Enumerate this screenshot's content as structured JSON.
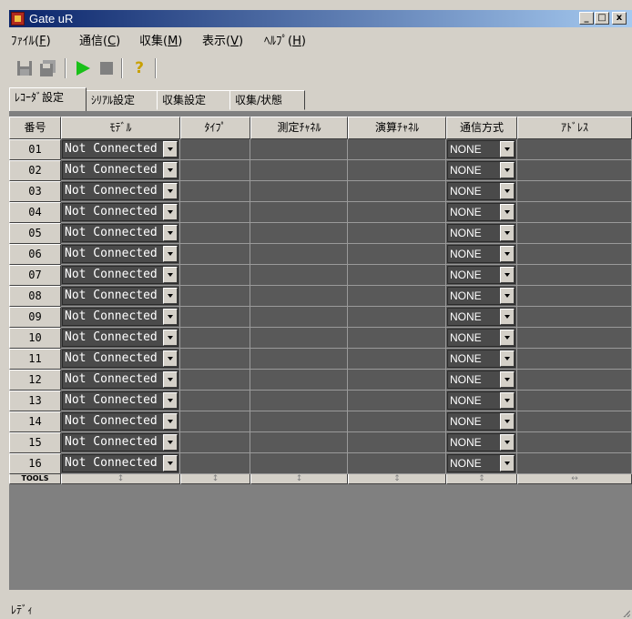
{
  "window": {
    "title": "Gate uR",
    "buttons": {
      "minimize": "_",
      "maximize": "□",
      "close": "x"
    }
  },
  "menu": [
    {
      "label": "ﾌｧｲﾙ(",
      "acc": "F",
      "suffix": ")"
    },
    {
      "label": "通信(",
      "acc": "C",
      "suffix": ")"
    },
    {
      "label": "収集(",
      "acc": "M",
      "suffix": ")"
    },
    {
      "label": "表示(",
      "acc": "V",
      "suffix": ")"
    },
    {
      "label": "ﾍﾙﾌﾟ(",
      "acc": "H",
      "suffix": ")"
    }
  ],
  "toolbar": {
    "help_glyph": "?"
  },
  "tabs": [
    "ﾚｺｰﾀﾞ設定",
    "ｼﾘｱﾙ設定",
    "収集設定",
    "収集/状態"
  ],
  "grid": {
    "columns": [
      "番号",
      "ﾓﾃﾞﾙ",
      "ﾀｲﾌﾟ",
      "測定ﾁｬﾈﾙ",
      "演算ﾁｬﾈﾙ",
      "通信方式",
      "ｱﾄﾞﾚｽ"
    ],
    "rows": [
      {
        "no": "01",
        "model": "Not Connected",
        "comm": "NONE"
      },
      {
        "no": "02",
        "model": "Not Connected",
        "comm": "NONE"
      },
      {
        "no": "03",
        "model": "Not Connected",
        "comm": "NONE"
      },
      {
        "no": "04",
        "model": "Not Connected",
        "comm": "NONE"
      },
      {
        "no": "05",
        "model": "Not Connected",
        "comm": "NONE"
      },
      {
        "no": "06",
        "model": "Not Connected",
        "comm": "NONE"
      },
      {
        "no": "07",
        "model": "Not Connected",
        "comm": "NONE"
      },
      {
        "no": "08",
        "model": "Not Connected",
        "comm": "NONE"
      },
      {
        "no": "09",
        "model": "Not Connected",
        "comm": "NONE"
      },
      {
        "no": "10",
        "model": "Not Connected",
        "comm": "NONE"
      },
      {
        "no": "11",
        "model": "Not Connected",
        "comm": "NONE"
      },
      {
        "no": "12",
        "model": "Not Connected",
        "comm": "NONE"
      },
      {
        "no": "13",
        "model": "Not Connected",
        "comm": "NONE"
      },
      {
        "no": "14",
        "model": "Not Connected",
        "comm": "NONE"
      },
      {
        "no": "15",
        "model": "Not Connected",
        "comm": "NONE"
      },
      {
        "no": "16",
        "model": "Not Connected",
        "comm": "NONE"
      }
    ],
    "footer_label": "TOOLS",
    "footer_glyphs": [
      "↕",
      "↕",
      "↕",
      "↕",
      "↕",
      "↔"
    ]
  },
  "status": {
    "text": "ﾚﾃﾞｨ"
  }
}
